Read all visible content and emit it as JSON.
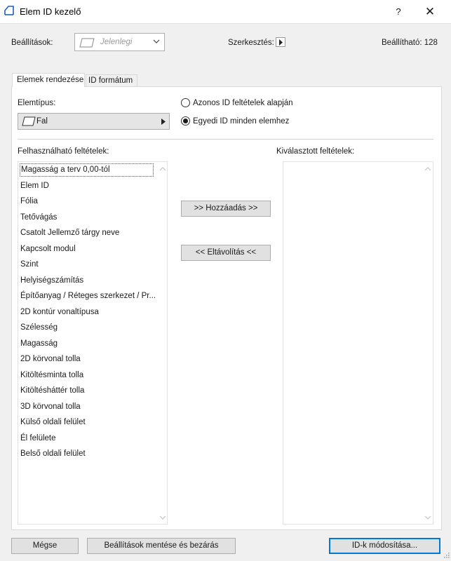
{
  "window": {
    "title": "Elem ID kezelő",
    "help": "?",
    "close": "✕"
  },
  "toolbar": {
    "settings_label": "Beállítások:",
    "settings_value": "Jelenlegi",
    "edit_label": "Szerkesztés:",
    "settable_label": "Beállítható: 128"
  },
  "tabs": [
    {
      "label": "Elemek rendezése",
      "active": true
    },
    {
      "label": "ID formátum",
      "active": false
    }
  ],
  "elemtype": {
    "label": "Elemtípus:",
    "value": "Fal"
  },
  "radios": [
    {
      "label": "Azonos ID feltételek alapján",
      "checked": false
    },
    {
      "label": "Egyedi ID minden elemhez",
      "checked": true
    }
  ],
  "available": {
    "label": "Felhasználható feltételek:",
    "items": [
      "Magasság a terv 0,00-tól",
      "Elem ID",
      "Fólia",
      "Tetővágás",
      "Csatolt Jellemző tárgy neve",
      "Kapcsolt modul",
      "Szint",
      "Helyiségszámítás",
      "Építőanyag / Réteges szerkezet / Pr...",
      "2D kontúr vonaltípusa",
      "Szélesség",
      "Magasság",
      "2D körvonal tolla",
      "Kitöltésminta tolla",
      "Kitöltésháttér tolla",
      "3D körvonal tolla",
      "Külső oldali felület",
      "Él felülete",
      "Belső oldali felület"
    ]
  },
  "selected": {
    "label": "Kiválasztott feltételek:",
    "items": []
  },
  "buttons": {
    "add": ">> Hozzáadás >>",
    "remove": "<< Eltávolítás <<",
    "cancel": "Mégse",
    "save_close": "Beállítások mentése és bezárás",
    "modify": "ID-k módosítása..."
  },
  "colors": {
    "focus_border": "#0078d7",
    "background": "#f0f0f0"
  }
}
